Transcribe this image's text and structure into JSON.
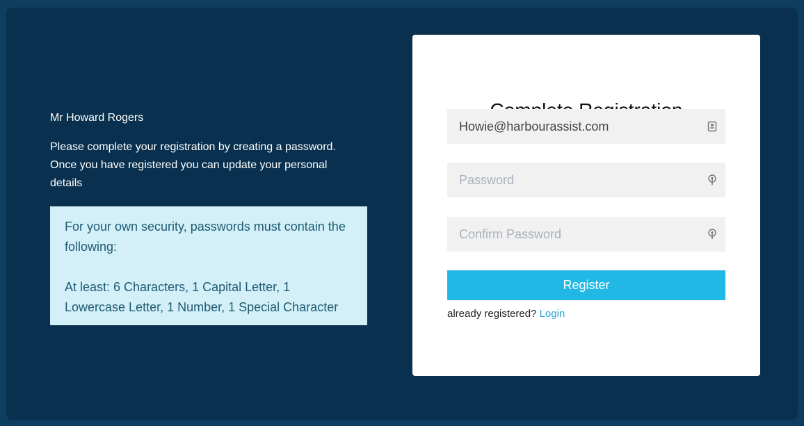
{
  "left_panel": {
    "user_name": "Mr Howard Rogers",
    "intro_text": "Please complete your registration by creating a password. Once you have registered you can update your personal details",
    "security_heading": "For your own security, passwords must contain the following:",
    "security_rules": "At least: 6 Characters, 1 Capital Letter, 1 Lowercase Letter, 1 Number, 1 Special Character"
  },
  "form": {
    "title": "Complete Registration",
    "email_value": "Howie@harbourassist.com",
    "email_icon": "id-card-icon",
    "password_placeholder": "Password",
    "password_icon": "key-icon",
    "confirm_password_placeholder": "Confirm Password",
    "confirm_password_icon": "key-icon",
    "register_label": "Register",
    "already_registered_text": "already registered?",
    "login_link_label": "Login"
  },
  "colors": {
    "page_background": "#0d3d5f",
    "panel_background": "#09314f",
    "info_box_background": "#d3f0f8",
    "button_accent": "#22b8e6",
    "link_color": "#2aa7d6"
  }
}
